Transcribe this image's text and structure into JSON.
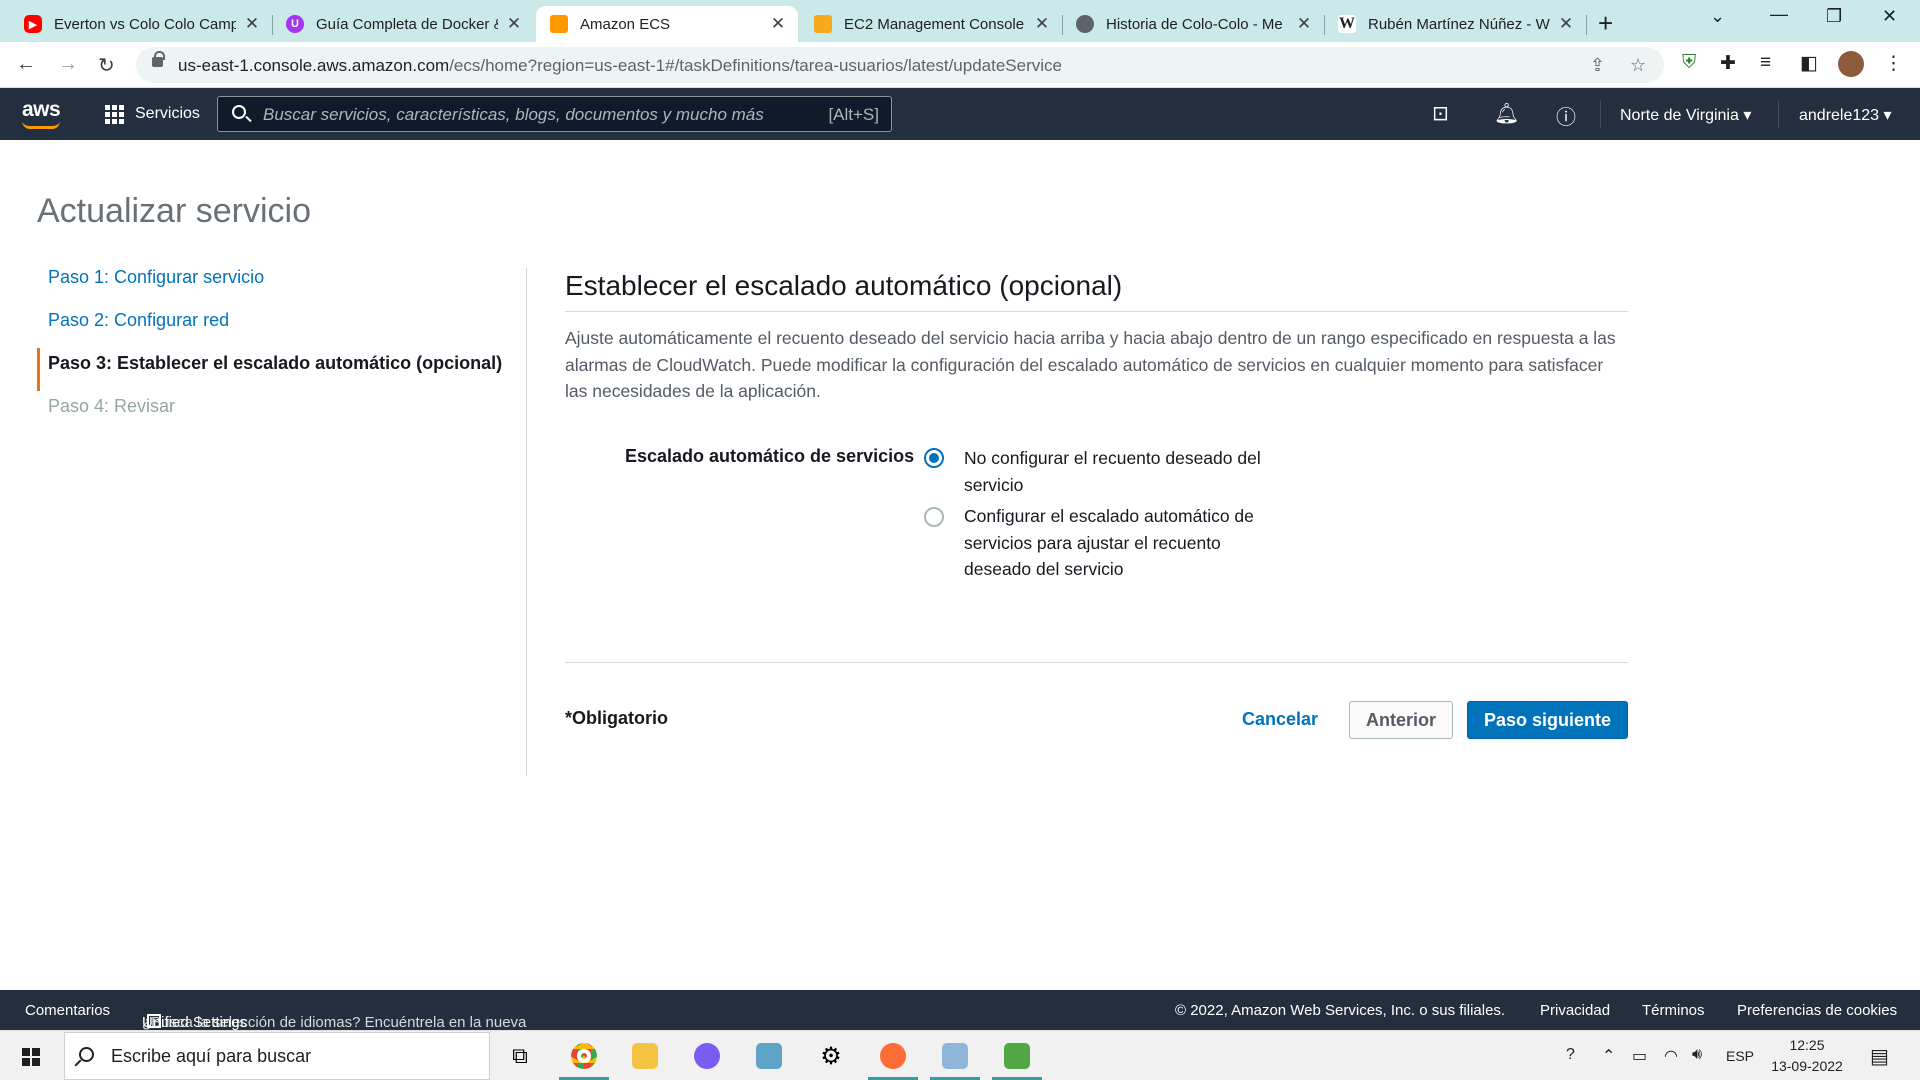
{
  "browser": {
    "tabs": [
      {
        "title": "Everton vs Colo Colo Camp",
        "favicon": "youtube-icon",
        "color": "#ff0000"
      },
      {
        "title": "Guía Completa de Docker &",
        "favicon": "udemy-icon",
        "color": "#a435f0"
      },
      {
        "title": "Amazon ECS",
        "favicon": "aws-ecs-icon",
        "color": "#ff9900"
      },
      {
        "title": "EC2 Management Console",
        "favicon": "aws-ec2-icon",
        "color": "#f7a81b"
      },
      {
        "title": "Historia de Colo-Colo - Me",
        "favicon": "globe-icon",
        "color": "#5f6368"
      },
      {
        "title": "Rubén Martínez Núñez - W",
        "favicon": "wikipedia-icon",
        "color": "#202124"
      }
    ],
    "url_host": "us-east-1.console.aws.amazon.com",
    "url_path": "/ecs/home?region=us-east-1#/taskDefinitions/tarea-usuarios/latest/updateService"
  },
  "aws_nav": {
    "logo": "aws",
    "services_label": "Servicios",
    "search_placeholder": "Buscar servicios, características, blogs, documentos y mucho más",
    "search_shortcut": "[Alt+S]",
    "region": "Norte de Virginia",
    "account": "andrele123"
  },
  "page": {
    "title": "Actualizar servicio",
    "steps": [
      {
        "label": "Paso 1: Configurar servicio",
        "state": "link"
      },
      {
        "label": "Paso 2: Configurar red",
        "state": "link"
      },
      {
        "label": "Paso 3: Establecer el escalado automático (opcional)",
        "state": "current"
      },
      {
        "label": "Paso 4: Revisar",
        "state": "disabled"
      }
    ],
    "section_title": "Establecer el escalado automático (opcional)",
    "description": "Ajuste automáticamente el recuento deseado del servicio hacia arriba y hacia abajo dentro de un rango especificado en respuesta a las alarmas de CloudWatch. Puede modificar la configuración del escalado automático de servicios en cualquier momento para satisfacer las necesidades de la aplicación.",
    "field_label": "Escalado automático de servicios",
    "options": [
      {
        "label": "No configurar el recuento deseado del servicio",
        "checked": true
      },
      {
        "label": "Configurar el escalado automático de servicios para ajustar el recuento deseado del servicio",
        "checked": false
      }
    ],
    "required_note": "*Obligatorio",
    "buttons": {
      "cancel": "Cancelar",
      "previous": "Anterior",
      "next": "Paso siguiente"
    }
  },
  "footer": {
    "feedback": "Comentarios",
    "language_prompt": "¿Busca la selección de idiomas? Encuéntrela en la nueva",
    "unified_settings": "Unified Settings",
    "copyright": "© 2022, Amazon Web Services, Inc. o sus filiales.",
    "privacy": "Privacidad",
    "terms": "Términos",
    "cookies": "Preferencias de cookies"
  },
  "taskbar": {
    "search_placeholder": "Escribe aquí para buscar",
    "language": "ESP",
    "time": "12:25",
    "date": "13-09-2022"
  },
  "colors": {
    "aws_nav_bg": "#232f3e",
    "link": "#0073bb",
    "primary_button": "#0073bb",
    "current_step_accent": "#ec7211",
    "tabbar_bg": "#cbe9e9"
  }
}
